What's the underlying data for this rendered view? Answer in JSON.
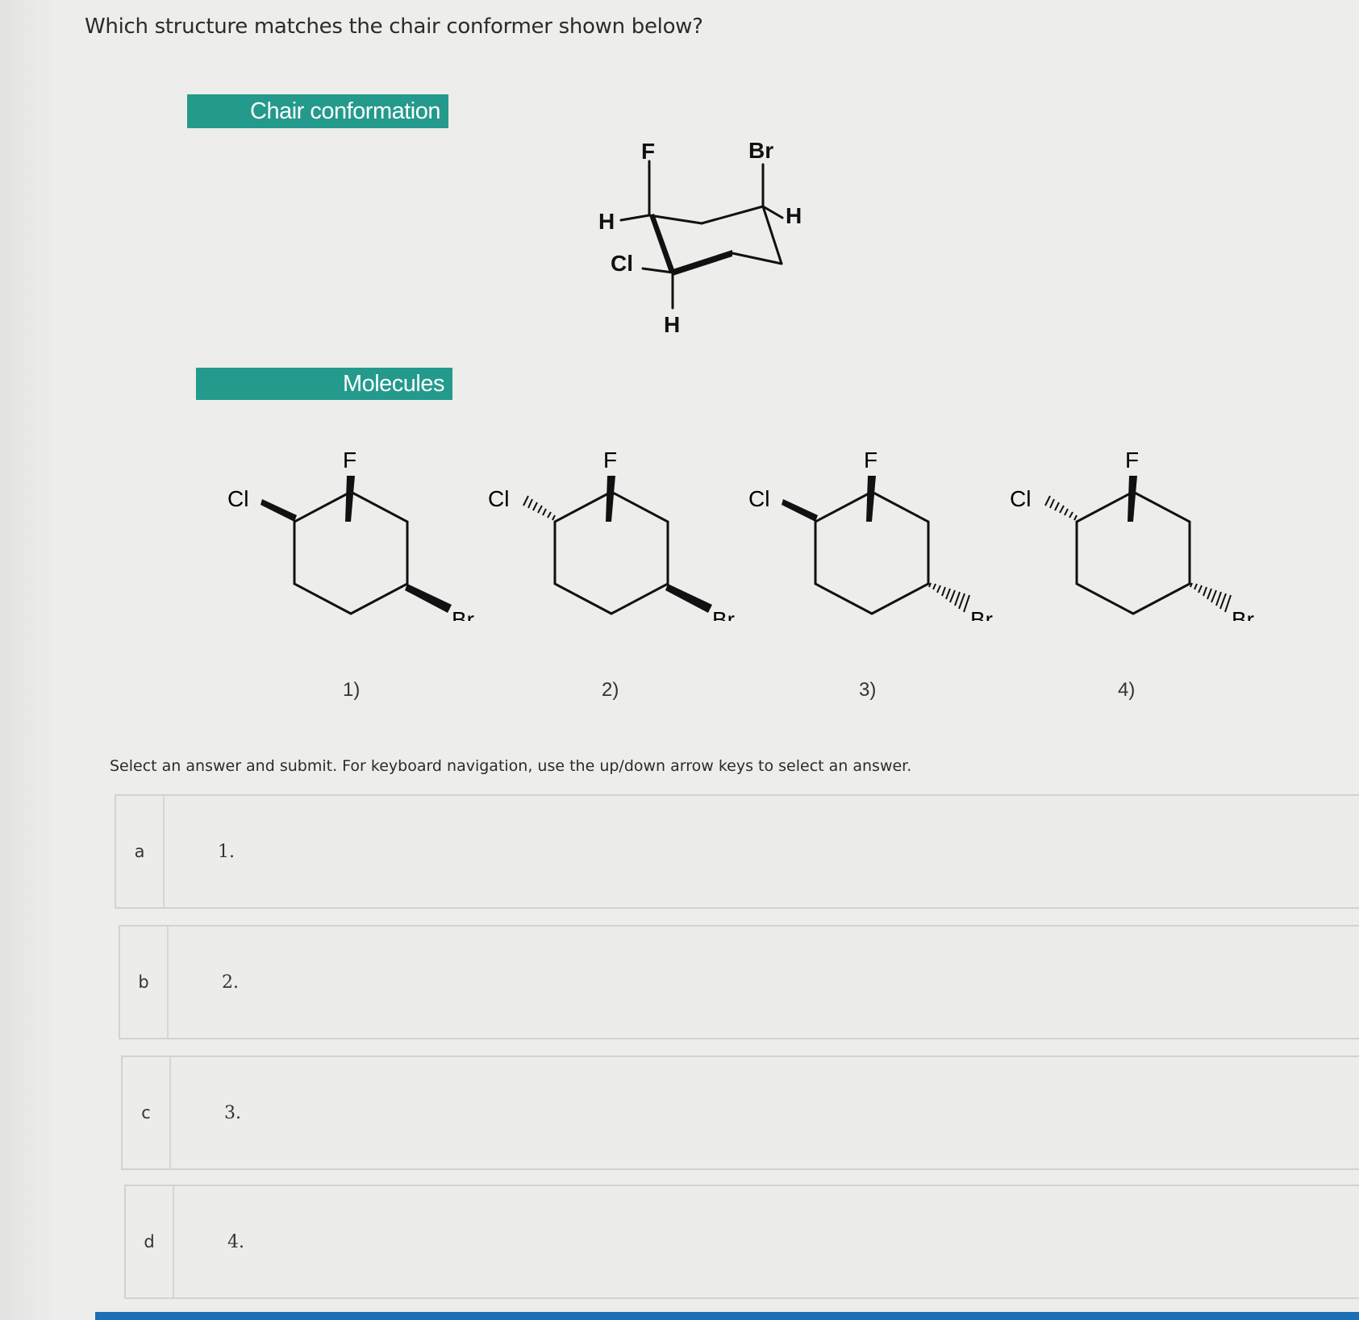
{
  "question": "Which structure matches the chair conformer shown below?",
  "chair_banner": "Chair conformation",
  "molecules_banner": "Molecules",
  "chair": {
    "labels": {
      "F": "F",
      "Br": "Br",
      "H_left": "H",
      "H_right": "H",
      "Cl": "Cl",
      "H_bottom": "H"
    }
  },
  "molecules": [
    {
      "number": "1)",
      "F": "F",
      "Cl": "Cl",
      "Br": "Br",
      "cl_bond": "wedge",
      "br_bond": "wedge"
    },
    {
      "number": "2)",
      "F": "F",
      "Cl": "Cl",
      "Br": "Br",
      "cl_bond": "hash",
      "br_bond": "wedge"
    },
    {
      "number": "3)",
      "F": "F",
      "Cl": "Cl",
      "Br": "Br",
      "cl_bond": "wedge",
      "br_bond": "hash"
    },
    {
      "number": "4)",
      "F": "F",
      "Cl": "Cl",
      "Br": "Br",
      "cl_bond": "hash",
      "br_bond": "hash"
    }
  ],
  "instructions": "Select an answer and submit. For keyboard navigation, use the up/down arrow keys to select an answer.",
  "options": [
    {
      "letter": "a",
      "text": "1."
    },
    {
      "letter": "b",
      "text": "2."
    },
    {
      "letter": "c",
      "text": "3."
    },
    {
      "letter": "d",
      "text": "4."
    }
  ],
  "colors": {
    "banner": "#239a8c",
    "bottom_bar": "#1b6fb5"
  }
}
